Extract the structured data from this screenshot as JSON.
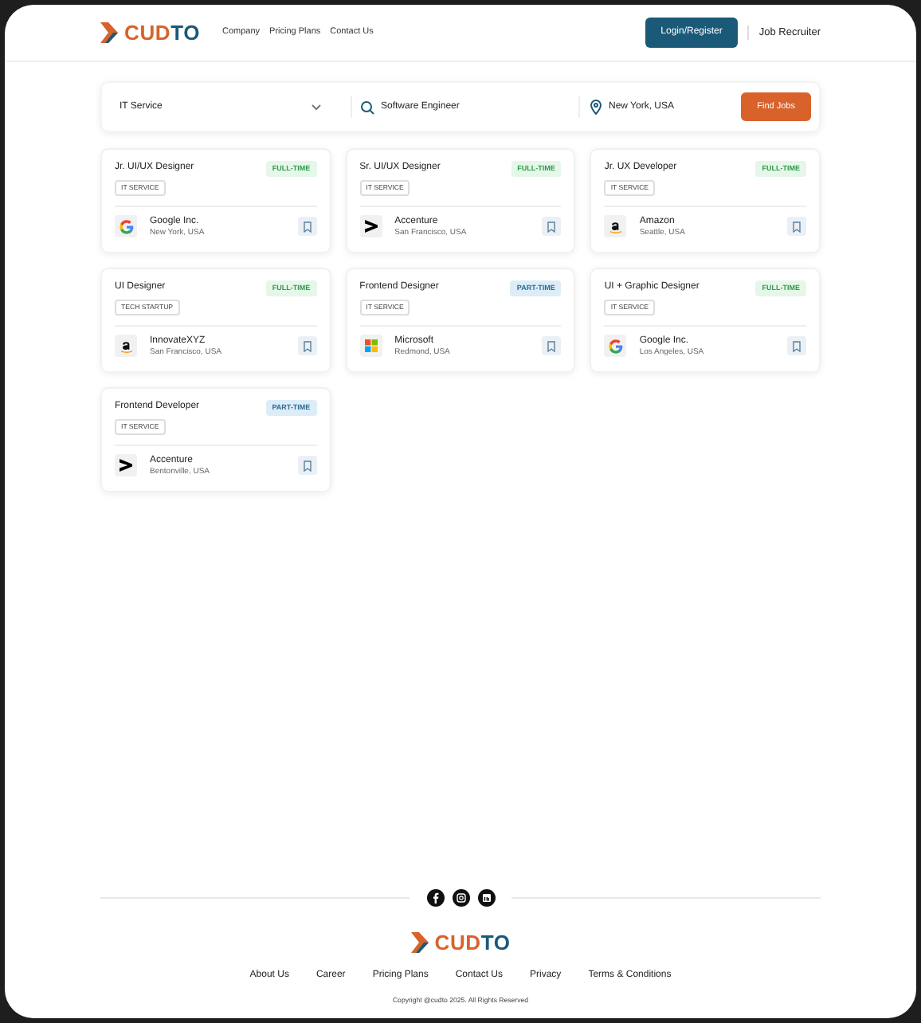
{
  "header": {
    "logo": {
      "part_1": "CUD",
      "part_2": "TO"
    },
    "nav": [
      "Company",
      "Pricing Plans",
      "Contact Us"
    ],
    "login_button": "Login/Register",
    "recruiter_link": "Job Recruiter"
  },
  "search": {
    "category": "IT Service",
    "keyword": "Software Engineer",
    "location": "New York, USA",
    "button": "Find Jobs"
  },
  "jobs": [
    {
      "title": "Jr. UI/UX Designer",
      "type": {
        "label": "FULL-TIME",
        "kind": "full"
      },
      "tag": "IT SERVICE",
      "company": {
        "name": "Google Inc.",
        "kind": "google",
        "location": "New York, USA"
      }
    },
    {
      "title": "Sr. UI/UX Designer",
      "type": {
        "label": "FULL-TIME",
        "kind": "full"
      },
      "tag": "IT SERVICE",
      "company": {
        "name": "Accenture",
        "kind": "accenture",
        "location": "San Francisco, USA"
      }
    },
    {
      "title": "Jr. UX Developer",
      "type": {
        "label": "FULL-TIME",
        "kind": "full"
      },
      "tag": "IT SERVICE",
      "company": {
        "name": "Amazon",
        "kind": "amazon",
        "location": "Seattle, USA"
      }
    },
    {
      "title": "UI Designer",
      "type": {
        "label": "FULL-TIME",
        "kind": "full"
      },
      "tag": "TECH STARTUP",
      "company": {
        "name": "InnovateXYZ",
        "kind": "amazon",
        "location": "San Francisco, USA"
      }
    },
    {
      "title": "Frontend Designer",
      "type": {
        "label": "PART-TIME",
        "kind": "part"
      },
      "tag": "IT SERVICE",
      "company": {
        "name": "Microsoft",
        "kind": "microsoft",
        "location": "Redmond, USA"
      }
    },
    {
      "title": "UI + Graphic Designer",
      "type": {
        "label": "FULL-TIME",
        "kind": "full"
      },
      "tag": "IT SERVICE",
      "company": {
        "name": "Google Inc.",
        "kind": "google",
        "location": "Los Angeles, USA"
      }
    },
    {
      "title": "Frontend Developer",
      "type": {
        "label": "PART-TIME",
        "kind": "part"
      },
      "tag": "IT SERVICE",
      "company": {
        "name": "Accenture",
        "kind": "accenture",
        "location": "Bentonville, USA"
      }
    }
  ],
  "footer": {
    "logo": {
      "part_1": "CUD",
      "part_2": "TO"
    },
    "links": [
      "About Us",
      "Career",
      "Pricing Plans",
      "Contact Us",
      "Privacy",
      "Terms & Conditions"
    ],
    "copyright": "Copyright @cudto 2025. All Rights Reserved"
  }
}
